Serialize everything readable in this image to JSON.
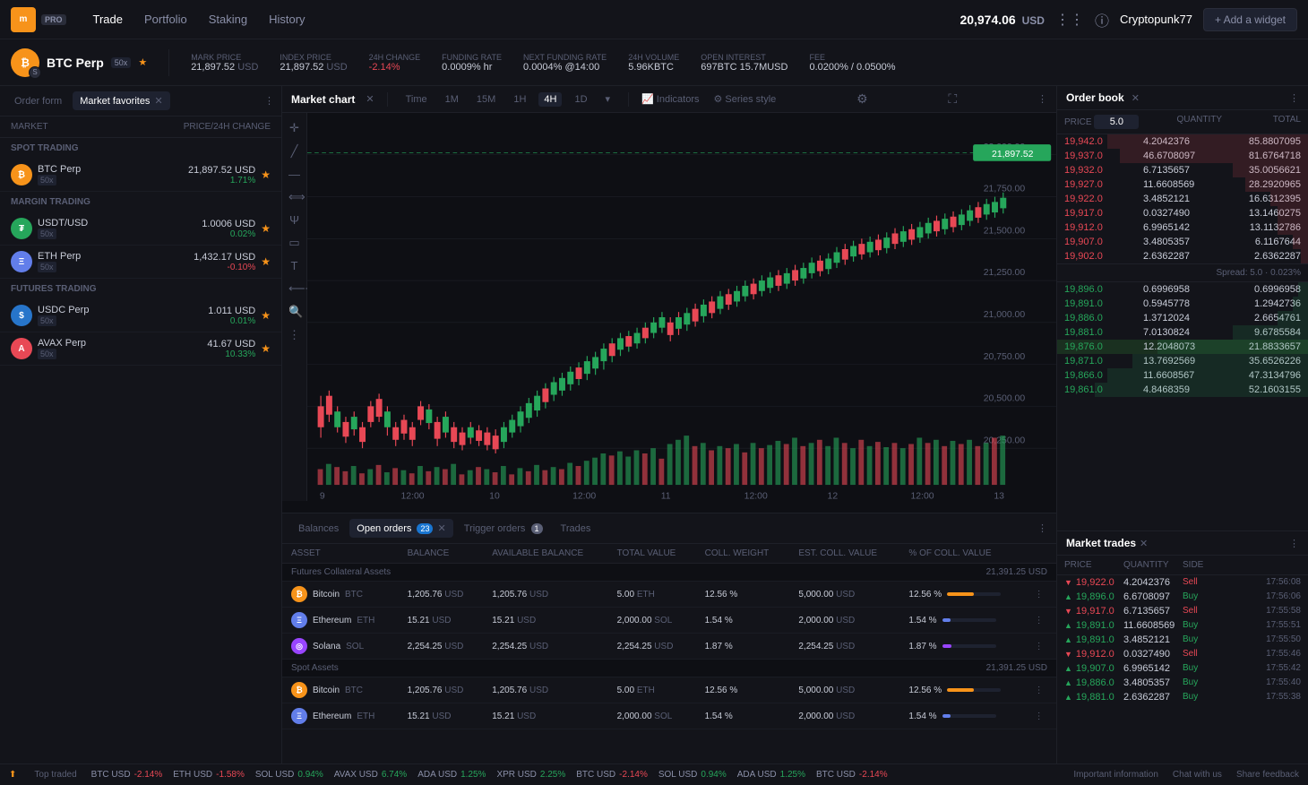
{
  "topnav": {
    "logo_text": "m",
    "pro_label": "PRO",
    "links": [
      "Trade",
      "Portfolio",
      "Staking",
      "History"
    ],
    "active_link": "Trade",
    "balance": "20,974.06",
    "balance_currency": "USD",
    "user": "Cryptopunk77",
    "add_widget": "+ Add a widget"
  },
  "instrument": {
    "name": "BTC Perp",
    "leverage": "50x",
    "mark_price_label": "MARK PRICE",
    "mark_price": "21,897.52",
    "mark_price_unit": "USD",
    "index_price_label": "INDEX PRICE",
    "index_price": "21,897.52",
    "index_price_unit": "USD",
    "change_label": "24H CHANGE",
    "change": "-2.14%",
    "funding_rate_label": "FUNDING RATE",
    "funding_rate": "0.0009%",
    "funding_unit": "hr",
    "next_funding_label": "NEXT FUNDING RATE",
    "next_funding": "0.0004%",
    "next_funding_time": "@14:00",
    "volume_label": "24H VOLUME",
    "volume": "5.96K",
    "volume_unit": "BTC",
    "open_interest_label": "OPEN INTEREST",
    "open_interest_btc": "697BTC",
    "open_interest_usd": "15.7MUSD",
    "fee_label": "FEE",
    "fee": "0.0200% / 0.0500%"
  },
  "left_panel": {
    "tabs": [
      "Order form",
      "Market favorites"
    ],
    "active_tab": "Market favorites",
    "market_col": "MARKET",
    "price_col": "PRICE/24H CHANGE",
    "sections": [
      {
        "label": "SPOT TRADING",
        "items": [
          {
            "coin": "BTC",
            "name": "BTC Perp",
            "leverage": "50x",
            "price": "21,897.52",
            "unit": "USD",
            "change": "1.71%",
            "positive": true,
            "starred": true
          }
        ]
      },
      {
        "label": "MARGIN TRADING",
        "items": [
          {
            "coin": "USDT",
            "name": "USDT/USD",
            "leverage": "50x",
            "price": "1.0006",
            "unit": "USD",
            "change": "0.02%",
            "positive": true,
            "starred": true
          },
          {
            "coin": "ETH",
            "name": "ETH Perp",
            "leverage": "50x",
            "price": "1,432.17",
            "unit": "USD",
            "change": "-0.10%",
            "positive": false,
            "starred": true
          }
        ]
      },
      {
        "label": "FUTURES TRADING",
        "items": [
          {
            "coin": "USDC",
            "name": "USDC Perp",
            "leverage": "50x",
            "price": "1.011",
            "unit": "USD",
            "change": "0.01%",
            "positive": true,
            "starred": true
          },
          {
            "coin": "AVAX",
            "name": "AVAX Perp",
            "leverage": "50x",
            "price": "41.67",
            "unit": "USD",
            "change": "10.33%",
            "positive": true,
            "starred": true
          }
        ]
      }
    ]
  },
  "chart": {
    "title": "Market chart",
    "time_buttons": [
      "Time",
      "1M",
      "15M",
      "1H",
      "4H",
      "1D"
    ],
    "active_time": "4H",
    "indicators": "Indicators",
    "series_style": "Series style",
    "price_label": "22,000.00",
    "price_current": "21,897.52"
  },
  "bottom_panel": {
    "tabs": [
      "Balances",
      "Open orders",
      "Trigger orders",
      "Trades"
    ],
    "active_tab": "Balances",
    "open_orders_count": "23",
    "trigger_orders_count": "1",
    "columns": [
      "ASSET",
      "BALANCE",
      "AVAILABLE BALANCE",
      "TOTAL VALUE",
      "COLL. WEIGHT",
      "EST. COLL. VALUE",
      "% OF COLL. VALUE"
    ],
    "futures_total": "21,391.25 USD",
    "spot_total": "21,391.25 USD",
    "sections": [
      {
        "label": "Futures Collateral Assets",
        "total": "21,391.25 USD",
        "rows": [
          {
            "coin": "BTC",
            "name": "Bitcoin",
            "ticker": "BTC",
            "balance": "1,205.76",
            "unit": "USD",
            "avail_balance": "1,205.76",
            "avail_unit": "USD",
            "total_value": "5.00",
            "tv_unit": "ETH",
            "coll_weight": "12.56",
            "est_coll": "5,000.00",
            "ec_unit": "USD",
            "pct_coll": "12.56",
            "bar_color": "#f7931a"
          },
          {
            "coin": "ETH",
            "name": "Ethereum",
            "ticker": "ETH",
            "balance": "15.21",
            "unit": "USD",
            "avail_balance": "15.21",
            "avail_unit": "USD",
            "total_value": "2,000.00",
            "tv_unit": "SOL",
            "coll_weight": "1.54",
            "est_coll": "2,000.00",
            "ec_unit": "USD",
            "pct_coll": "1.54",
            "bar_color": "#627eea"
          },
          {
            "coin": "SOL",
            "name": "Solana",
            "ticker": "SOL",
            "balance": "2,254.25",
            "unit": "USD",
            "avail_balance": "2,254.25",
            "avail_unit": "USD",
            "total_value": "2,254.25",
            "tv_unit": "USD",
            "coll_weight": "1.87",
            "est_coll": "2,254.25",
            "ec_unit": "USD",
            "pct_coll": "1.87",
            "bar_color": "#9945ff"
          }
        ]
      },
      {
        "label": "Spot Assets",
        "total": "21,391.25 USD",
        "rows": [
          {
            "coin": "BTC",
            "name": "Bitcoin",
            "ticker": "BTC",
            "balance": "1,205.76",
            "unit": "USD",
            "avail_balance": "1,205.76",
            "avail_unit": "USD",
            "total_value": "5.00",
            "tv_unit": "ETH",
            "coll_weight": "12.56",
            "est_coll": "5,000.00",
            "ec_unit": "USD",
            "pct_coll": "12.56",
            "bar_color": "#f7931a"
          },
          {
            "coin": "ETH",
            "name": "Ethereum",
            "ticker": "ETH",
            "balance": "15.21",
            "unit": "USD",
            "avail_balance": "15.21",
            "avail_unit": "USD",
            "total_value": "2,000.00",
            "tv_unit": "SOL",
            "coll_weight": "1.54",
            "est_coll": "2,000.00",
            "ec_unit": "USD",
            "pct_coll": "1.54",
            "bar_color": "#627eea"
          }
        ]
      }
    ]
  },
  "orderbook": {
    "title": "Order book",
    "price_input": "5.0",
    "columns": [
      "PRICE",
      "QUANTITY",
      "TOTAL"
    ],
    "spread": "Spread: 5.0 · 0.023%",
    "sell_rows": [
      {
        "price": "19,942.0",
        "qty": "4.2042376",
        "total": "85.8807095",
        "bg_width": "80"
      },
      {
        "price": "19,937.0",
        "qty": "46.6708097",
        "total": "81.6764718",
        "bg_width": "75"
      },
      {
        "price": "19,932.0",
        "qty": "6.7135657",
        "total": "35.0056621",
        "bg_width": "30"
      },
      {
        "price": "19,927.0",
        "qty": "11.6608569",
        "total": "28.2920965",
        "bg_width": "25"
      },
      {
        "price": "19,922.0",
        "qty": "3.4852121",
        "total": "16.6312395",
        "bg_width": "15"
      },
      {
        "price": "19,917.0",
        "qty": "0.0327490",
        "total": "13.1460275",
        "bg_width": "12"
      },
      {
        "price": "19,912.0",
        "qty": "6.9965142",
        "total": "13.1132786",
        "bg_width": "12"
      },
      {
        "price": "19,907.0",
        "qty": "3.4805357",
        "total": "6.1167644",
        "bg_width": "6"
      },
      {
        "price": "19,902.0",
        "qty": "2.6362287",
        "total": "2.6362287",
        "bg_width": "3"
      }
    ],
    "buy_rows": [
      {
        "price": "19,896.0",
        "qty": "0.6996958",
        "total": "0.6996958",
        "bg_width": "4"
      },
      {
        "price": "19,891.0",
        "qty": "0.5945778",
        "total": "1.2942736",
        "bg_width": "6"
      },
      {
        "price": "19,886.0",
        "qty": "1.3712024",
        "total": "2.6654761",
        "bg_width": "12"
      },
      {
        "price": "19,881.0",
        "qty": "7.0130824",
        "total": "9.6785584",
        "bg_width": "30"
      },
      {
        "price": "19,876.0",
        "qty": "12.2048073",
        "total": "21.8833657",
        "bg_width": "60"
      },
      {
        "price": "19,871.0",
        "qty": "13.7692569",
        "total": "35.6526226",
        "bg_width": "70"
      },
      {
        "price": "19,866.0",
        "qty": "11.6608567",
        "total": "47.3134796",
        "bg_width": "80"
      },
      {
        "price": "19,861.0",
        "qty": "4.8468359",
        "total": "52.1603155",
        "bg_width": "85"
      }
    ]
  },
  "market_trades": {
    "title": "Market trades",
    "columns": [
      "PRICE",
      "QUANTITY",
      "SIDE",
      ""
    ],
    "rows": [
      {
        "price": "19,922.0",
        "qty": "4.2042376",
        "side": "Sell",
        "time": "17:56:08",
        "up": false
      },
      {
        "price": "19,896.0",
        "qty": "6.6708097",
        "side": "Buy",
        "time": "17:56:06",
        "up": true
      },
      {
        "price": "19,917.0",
        "qty": "6.7135657",
        "side": "Sell",
        "time": "17:55:58",
        "up": false
      },
      {
        "price": "19,891.0",
        "qty": "11.6608569",
        "side": "Buy",
        "time": "17:55:51",
        "up": true
      },
      {
        "price": "19,891.0",
        "qty": "3.4852121",
        "side": "Buy",
        "time": "17:55:50",
        "up": true
      },
      {
        "price": "19,912.0",
        "qty": "0.0327490",
        "side": "Sell",
        "time": "17:55:46",
        "up": false
      },
      {
        "price": "19,907.0",
        "qty": "6.9965142",
        "side": "Buy",
        "time": "17:55:42",
        "up": true
      },
      {
        "price": "19,886.0",
        "qty": "3.4805357",
        "side": "Buy",
        "time": "17:55:40",
        "up": true
      },
      {
        "price": "19,881.0",
        "qty": "2.6362287",
        "side": "Buy",
        "time": "17:55:38",
        "up": true
      }
    ]
  },
  "ticker": {
    "label": "Top traded",
    "items": [
      {
        "coin": "BTC USD",
        "change": "-2.14%",
        "positive": false
      },
      {
        "coin": "ETH USD",
        "change": "-1.58%",
        "positive": false
      },
      {
        "coin": "SOL USD",
        "change": "0.94%",
        "positive": true
      },
      {
        "coin": "AVAX USD",
        "change": "6.74%",
        "positive": true
      },
      {
        "coin": "ADA USD",
        "change": "1.25%",
        "positive": true
      },
      {
        "coin": "XPR USD",
        "change": "2.25%",
        "positive": true
      },
      {
        "coin": "BTC USD",
        "change": "-2.14%",
        "positive": false
      },
      {
        "coin": "SOL USD",
        "change": "0.94%",
        "positive": true
      },
      {
        "coin": "ADA USD",
        "change": "1.25%",
        "positive": true
      },
      {
        "coin": "BTC USD",
        "change": "-2.14%",
        "positive": false
      }
    ],
    "links": [
      "Important information",
      "Chat with us",
      "Share feedback"
    ]
  }
}
